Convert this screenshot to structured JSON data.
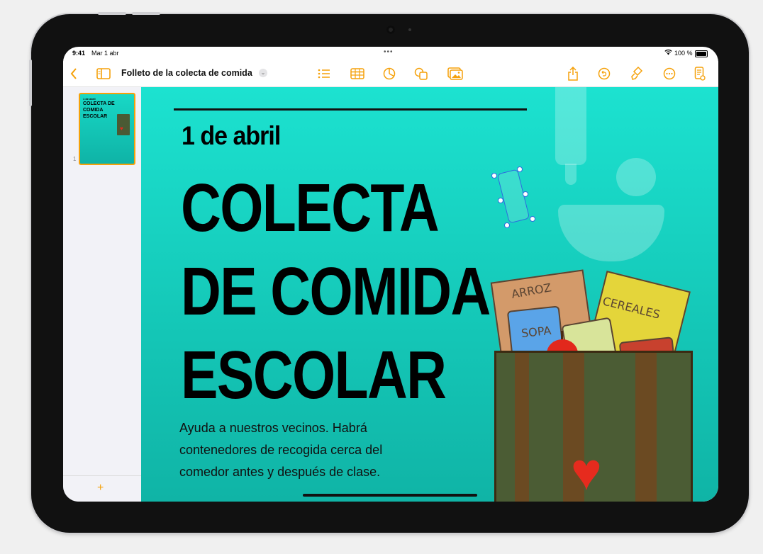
{
  "status_bar": {
    "time": "9:41",
    "date": "Mar 1 abr",
    "battery": "100 %"
  },
  "toolbar": {
    "doc_title": "Folleto de la colecta de comida",
    "icons": [
      "back-chevron-icon",
      "sidebar-toggle-icon",
      "title-chevron-icon",
      "list-icon",
      "table-icon",
      "chart-icon",
      "shape-icon",
      "media-icon",
      "share-icon",
      "undo-icon",
      "format-brush-icon",
      "more-icon",
      "reader-icon"
    ]
  },
  "sidebar": {
    "thumbnail_number": "1",
    "thumbnail_date": "1 de abril",
    "thumbnail_title": "COLECTA DE COMIDA ESCOLAR",
    "add_label": "+"
  },
  "canvas": {
    "date": "1 de abril",
    "headline_lines": [
      "COLECTA",
      "DE COMIDA",
      "ESCOLAR"
    ],
    "body_lines": [
      "Ayuda a nuestros vecinos. Habrá",
      "contenedores de recogida cerca del",
      "comedor antes y después de clase."
    ],
    "illustration": {
      "box_rice": "ARROZ",
      "can_soup": "SOPA",
      "box_cereal": "CEREALES"
    }
  },
  "colors": {
    "accent": "#f5a10a",
    "canvas_top": "#1ce2d0",
    "canvas_bottom": "#10b4a6",
    "heart": "#e62b1e"
  }
}
